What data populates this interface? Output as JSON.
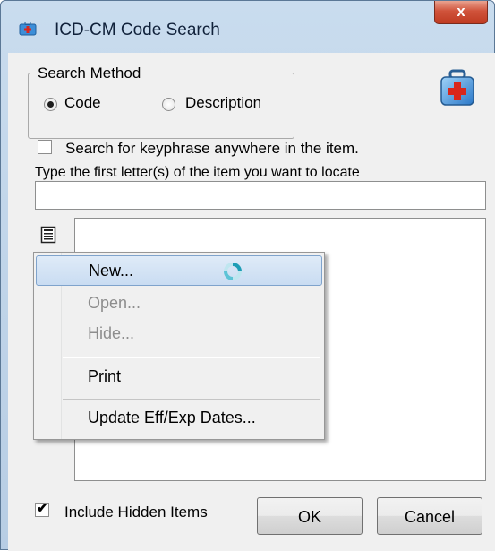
{
  "window": {
    "title": "ICD-CM Code Search",
    "close_label": "x"
  },
  "search_method": {
    "legend": "Search Method",
    "options": [
      {
        "label": "Code",
        "selected": true
      },
      {
        "label": "Description",
        "selected": false
      }
    ]
  },
  "anywhere_checkbox": {
    "label": "Search for keyphrase anywhere in the item.",
    "checked": false
  },
  "search_field": {
    "prompt": "Type the first letter(s) of the item you want to locate",
    "value": ""
  },
  "context_menu": {
    "items": [
      {
        "label": "New...",
        "state": "highlighted"
      },
      {
        "label": "Open...",
        "state": "disabled"
      },
      {
        "label": "Hide...",
        "state": "disabled"
      },
      {
        "label": "Print",
        "state": "enabled"
      },
      {
        "label": "Update Eff/Exp Dates...",
        "state": "enabled"
      }
    ]
  },
  "include_hidden": {
    "label": "Include Hidden Items",
    "checked": true,
    "check_glyph": "✔"
  },
  "buttons": {
    "ok": "OK",
    "cancel": "Cancel"
  },
  "icons": {
    "title": "medical-app-icon",
    "medkit": "medical-kit-icon",
    "menu": "list-menu-icon",
    "busy": "busy-spinner-icon"
  },
  "colors": {
    "title_bar": "#c9dcee",
    "close_button": "#c8462d",
    "menu_highlight": "#c9dcf2",
    "medical_cross": "#d9261c"
  }
}
